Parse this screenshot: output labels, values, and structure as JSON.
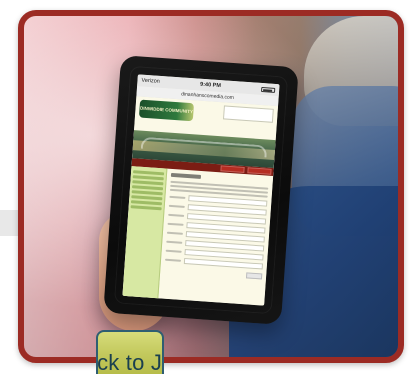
{
  "tablet": {
    "status": {
      "carrier": "Verizon",
      "time": "9:40 PM"
    },
    "url": "dinanhanscomedia.com",
    "logo_text": "DINWIDDIE\nCOMMUNITY"
  },
  "cta": {
    "label": "ick to Join"
  },
  "colors": {
    "frame": "#9c2b24",
    "cta_bg": "#c2c85c",
    "cta_text": "#1a3f4f"
  }
}
